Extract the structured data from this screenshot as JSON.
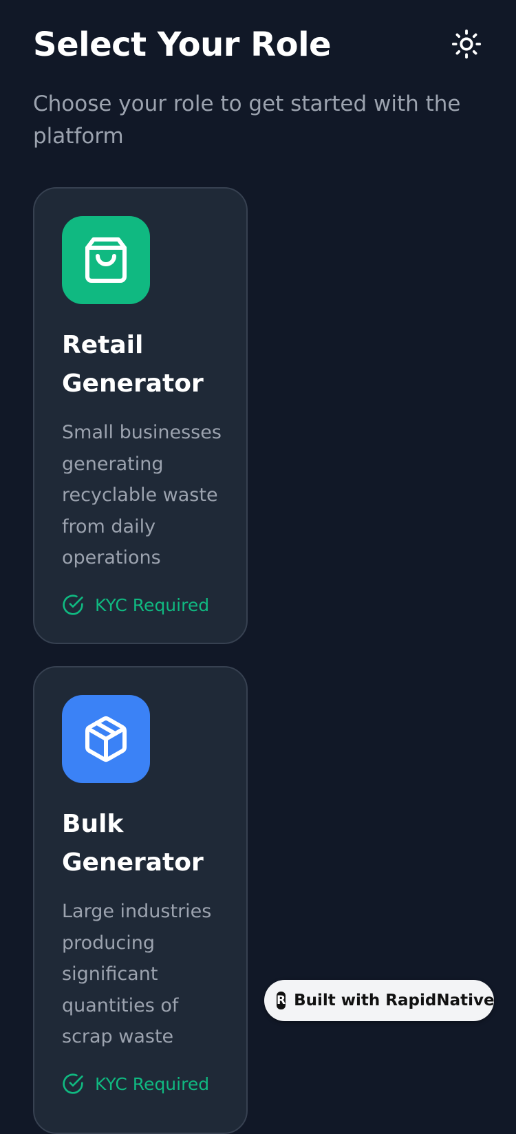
{
  "header": {
    "title": "Select Your Role",
    "subtitle": "Choose your role to get started with the platform",
    "theme_toggle_icon": "sun-icon"
  },
  "roles": [
    {
      "title": "Retail Generator",
      "description": "Small businesses generating recyclable waste from daily operations",
      "icon": "shopping-bag-icon",
      "icon_bg": "#10b981",
      "kyc_label": "KYC Required",
      "kyc_icon": "check-circle-icon"
    },
    {
      "title": "Bulk Generator",
      "description": "Large industries producing significant quantities of scrap waste",
      "icon": "package-icon",
      "icon_bg": "#3b82f6",
      "kyc_label": "KYC Required",
      "kyc_icon": "check-circle-icon"
    }
  ],
  "badge": {
    "label": "Built with RapidNative",
    "logo_glyph": "R"
  },
  "colors": {
    "background": "#111827",
    "card": "#1f2937",
    "card_border": "#374151",
    "accent_green": "#10b981",
    "accent_blue": "#3b82f6",
    "muted_text": "#9ca3af"
  }
}
